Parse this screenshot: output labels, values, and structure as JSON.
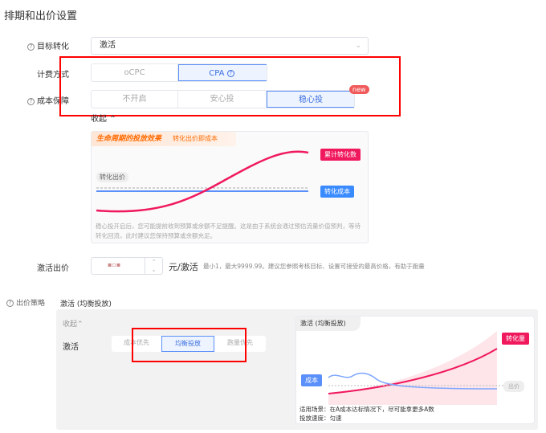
{
  "section_title": "排期和出价设置",
  "target": {
    "label": "目标转化",
    "value": "激活"
  },
  "billing": {
    "label": "计费方式",
    "options": [
      "oCPC",
      "CPA"
    ],
    "selected": "CPA"
  },
  "cost_guarantee": {
    "label": "成本保障",
    "options": [
      "不开启",
      "安心投",
      "稳心投"
    ],
    "selected": "稳心投",
    "badge": "new",
    "collapse": "收起"
  },
  "lifecycle_card": {
    "title": "生命周期的投放效果",
    "subtitle": "转化出价即成本",
    "bid_label": "转化出价",
    "cum_tag": "累计转化数",
    "cost_tag": "转化成本",
    "note": "稳心投开启后，您可能提前收到预算或余额不足提醒。这是由于系统会通过预估流量价值预判，等待转化回流，此时建议您保持预算或余额充足。"
  },
  "bid": {
    "label": "激活出价",
    "unit": "元/激活",
    "hint": "最小1，最大9999.99。建议您参照考核目标、设置可接受的最高价格，有助于跑量"
  },
  "strategy": {
    "label": "出价策略",
    "value": "激活 (均衡投放)",
    "collapse": "收起",
    "row_label": "激活",
    "options": [
      "成本优先",
      "均衡投放",
      "跑量优先"
    ],
    "selected": "均衡投放"
  },
  "strategy_card": {
    "title": "激活 (均衡投放)",
    "volume_tag": "转化量",
    "cost_tag": "成本",
    "bid_tag": "出价",
    "scene": "适用场景：在A成本达标情况下，尽可能拿更多A数",
    "speed": "投放速度：匀速"
  },
  "colors": {
    "accent": "#3a6fe0",
    "pink": "#f0195e",
    "highlight": "#ff0000"
  }
}
